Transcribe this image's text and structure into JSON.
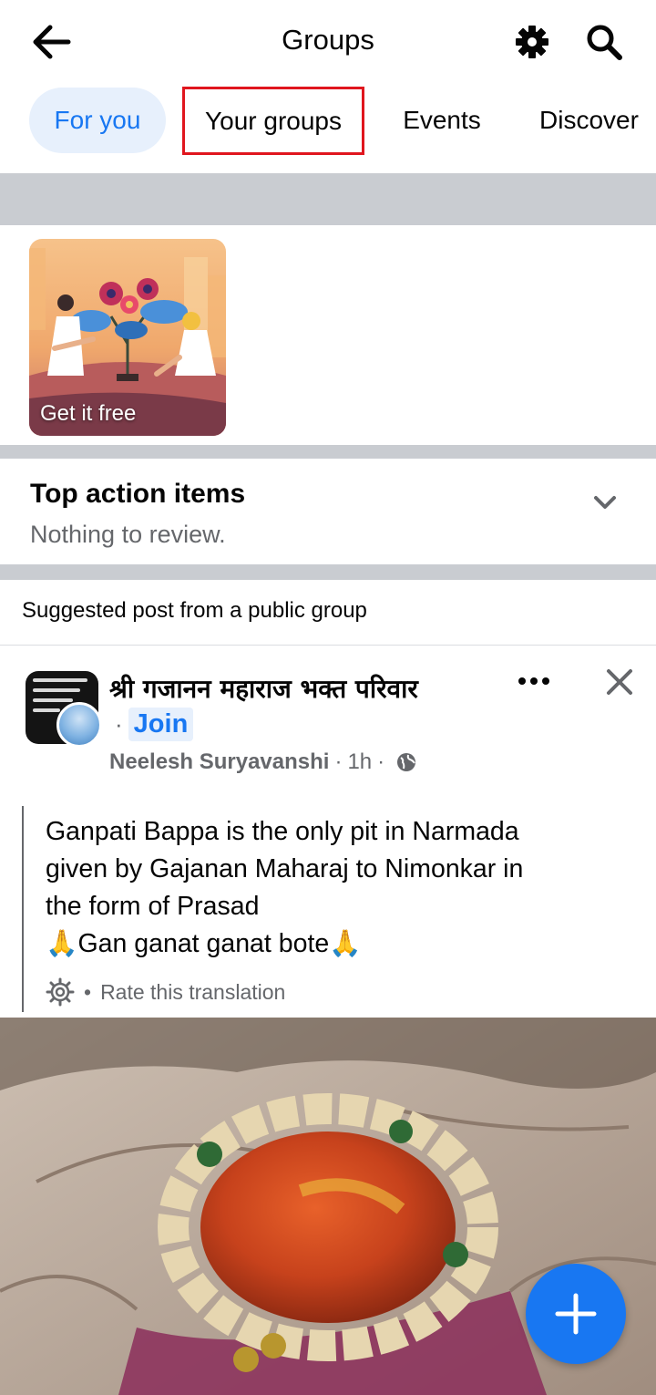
{
  "header": {
    "title": "Groups",
    "back_icon": "arrow-left-icon",
    "settings_icon": "gear-icon",
    "search_icon": "search-icon"
  },
  "tabs": [
    {
      "label": "For you",
      "active": true
    },
    {
      "label": "Your groups",
      "highlighted": true
    },
    {
      "label": "Events"
    },
    {
      "label": "Discover"
    }
  ],
  "promo": {
    "label": "Get it free"
  },
  "action_items": {
    "title": "Top action items",
    "subtitle": "Nothing to review."
  },
  "suggested": {
    "label": "Suggested post from a public group"
  },
  "post": {
    "group_name": "श्री गजानन महाराज भक्त परिवार",
    "join_separator": "·",
    "join_label": "Join",
    "author": "Neelesh Suryavanshi",
    "time": "1h",
    "meta_separator": "·",
    "visibility_icon": "globe-icon",
    "text_lines": [
      "Ganpati Bappa is the only pit in Narmada",
      "given by Gajanan Maharaj to Nimonkar in",
      "the form of Prasad",
      "🙏Gan ganat ganat bote🙏"
    ],
    "translate_separator": "•",
    "rate_translation": "Rate this translation"
  },
  "fab": {
    "icon": "plus-icon"
  },
  "colors": {
    "accent": "#1877f2",
    "accent_bg": "#e7f0fc",
    "highlight_box": "#e0161e",
    "divider": "#c9ccd1",
    "secondary_text": "#65676b"
  }
}
